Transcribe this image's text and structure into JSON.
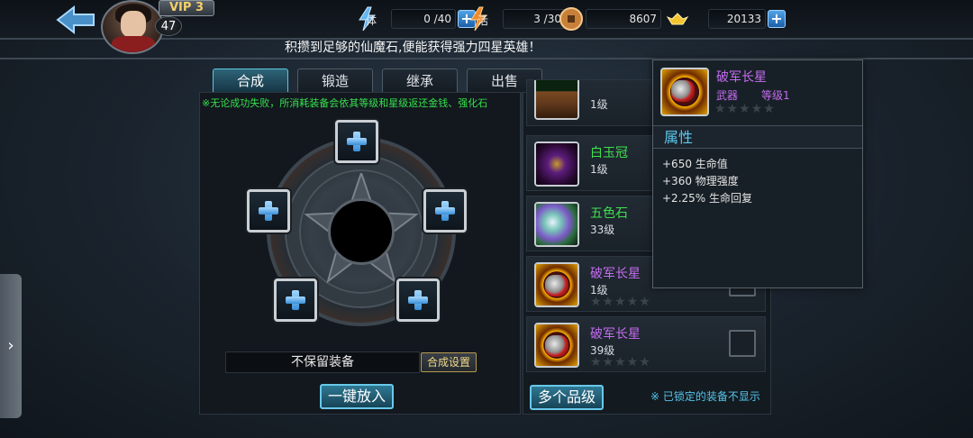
{
  "header": {
    "vip_label": "VIP 3",
    "player_level": "47",
    "stamina": {
      "label": "体",
      "value": "0 /40"
    },
    "activity": {
      "label": "活",
      "value": "3 /30"
    },
    "coins": "8607",
    "gold": "20133",
    "marquee": "积攒到足够的仙魔石,便能获得强力四星英雄！"
  },
  "tabs": [
    {
      "label": "合成",
      "active": true
    },
    {
      "label": "锻造",
      "active": false
    },
    {
      "label": "继承",
      "active": false
    },
    {
      "label": "出售",
      "active": false
    }
  ],
  "synthesis": {
    "notice": "※无论成功失败，所消耗装备会依其等级和星级返还金钱、强化石",
    "keep_label": "不保留装备",
    "settings_button": "合成设置",
    "auto_place_button": "一键放入"
  },
  "equipment_list": {
    "items": [
      {
        "name": "",
        "level": "1级",
        "art": "wood",
        "name_color": "#3fe04f"
      },
      {
        "name": "白玉冠",
        "level": "1级",
        "art": "crown",
        "name_color": "#3fe04f"
      },
      {
        "name": "五色石",
        "level": "33级",
        "art": "stone",
        "name_color": "#3fe04f"
      },
      {
        "name": "破军长星",
        "level": "1级",
        "art": "weapon",
        "name_color": "#c46cf0",
        "stars": "★★★★★"
      },
      {
        "name": "破军长星",
        "level": "39级",
        "art": "weapon",
        "name_color": "#c46cf0",
        "stars": "★★★★★"
      }
    ],
    "multi_grade_button": "多个品级",
    "lock_note": "※ 已锁定的装备不显示"
  },
  "tooltip": {
    "name": "破军长星",
    "type": "武器",
    "level": "等级1",
    "stars": "★★★★★",
    "section_title": "属性",
    "attributes": [
      "+650 生命值",
      "+360 物理强度",
      "+2.25% 生命回复"
    ]
  },
  "colors": {
    "accent_cyan": "#5cc8ef",
    "epic_purple": "#c46cf0",
    "uncommon_green": "#3fe04f",
    "notice_green": "#37e04d"
  },
  "icons": {
    "back": "back-arrow-icon",
    "stamina": "lightning-icon",
    "activity": "flame-lightning-icon",
    "coins": "copper-coin-icon",
    "gold": "gold-ingot-icon",
    "drawer": "chevron-right-icon"
  }
}
